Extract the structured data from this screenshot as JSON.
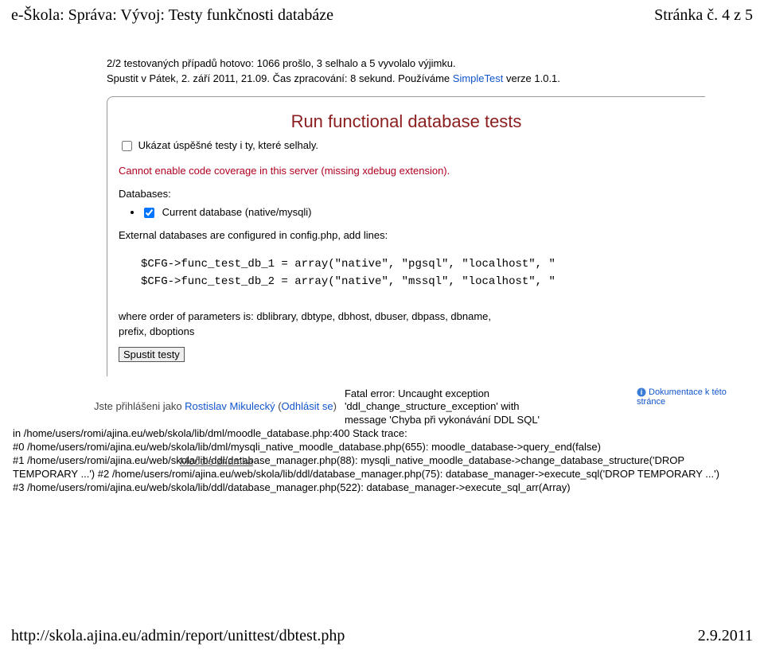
{
  "header": {
    "left": "e-Škola: Správa: Vývoj: Testy funkčnosti databáze",
    "right": "Stránka č. 4 z 5"
  },
  "summary": {
    "line1": "2/2 testovaných případů hotovo: 1066 prošlo, 3 selhalo a 5 vyvolalo výjimku.",
    "line2a": "Spustit v Pátek, 2. září 2011, 21.09. Čas zpracování: 8 sekund. Používáme ",
    "simpletest": "SimpleTest",
    "line2b": " verze 1.0.1."
  },
  "panel": {
    "title": "Run functional database tests",
    "cb1_label": "Ukázat úspěšné testy i ty, které selhaly.",
    "error_note": "Cannot enable code coverage in this server (missing xdebug extension).",
    "db_label": "Databases:",
    "cb2_label": "Current database (native/mysqli)",
    "ext_note": "External databases are configured in config.php, add lines:",
    "code_l1": "$CFG->func_test_db_1 = array(\"native\", \"pgsql\", \"localhost\", \"",
    "code_l2": "$CFG->func_test_db_2 = array(\"native\", \"mssql\", \"localhost\", \"",
    "where_l1": "where order of parameters is: dblibrary, dbtype, dbhost, dbuser, dbpass, dbname,",
    "where_l2": "prefix, dboptions",
    "button": "Spustit testy"
  },
  "login": {
    "prefix": "Jste přihlášeni jako ",
    "user": "Rostislav Mikulecký",
    "sep": " (",
    "logout": "Odhlásit se",
    "suffix": ")"
  },
  "fatal": {
    "l1": "Fatal error: Uncaught exception 'ddl_change_structure_exception' with",
    "l2": "message 'Chyba při vykonávání DDL SQL'"
  },
  "doclink": "Dokumentace k této stránce",
  "stack": {
    "s0": "in /home/users/romi/ajina.eu/web/skola/lib/dml/moodle_database.php:400 Stack trace:",
    "s1": "#0 /home/users/romi/ajina.eu/web/skola/lib/dml/mysqli_native_moodle_database.php(655): moodle_database->query_end(false)",
    "s2": "#1 /home/users/romi/ajina.eu/web/skola/lib/ddl/database_manager.php(88): mysqli_native_moodle_database->change_database_structure('DROP",
    "moodle": "Moodle znamka",
    "s3": "TEMPORARY ...') #2 /home/users/romi/ajina.eu/web/skola/lib/ddl/database_manager.php(75): database_manager->execute_sql('DROP TEMPORARY ...')",
    "s4": "#3 /home/users/romi/ajina.eu/web/skola/lib/ddl/database_manager.php(522): database_manager->execute_sql_arr(Array)"
  },
  "footer": {
    "left": "http://skola.ajina.eu/admin/report/unittest/dbtest.php",
    "right": "2.9.2011"
  }
}
